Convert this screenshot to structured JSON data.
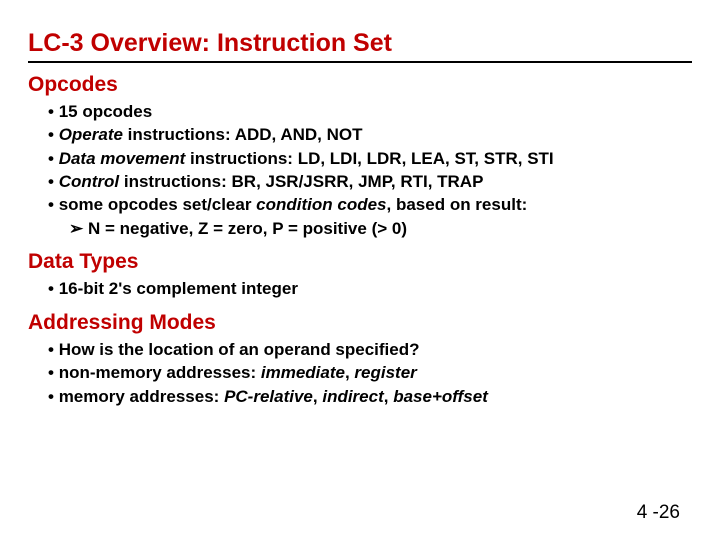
{
  "title": "LC-3 Overview: Instruction Set",
  "sections": {
    "opcodes": {
      "heading": "Opcodes",
      "b1": "15 opcodes",
      "b2_pre": "Operate",
      "b2_rest": " instructions: ADD, AND, NOT",
      "b3_pre": "Data movement",
      "b3_rest": " instructions: LD, LDI, LDR, LEA, ST, STR, STI",
      "b4_pre": "Control",
      "b4_rest": " instructions: BR, JSR/JSRR, JMP, RTI, TRAP",
      "b5_a": "some opcodes set/clear ",
      "b5_b": "condition codes",
      "b5_c": ", based on result:",
      "b5_sub": "N = negative, Z = zero, P = positive (> 0)"
    },
    "datatypes": {
      "heading": "Data Types",
      "b1": "16-bit 2's complement integer"
    },
    "addrmodes": {
      "heading": "Addressing Modes",
      "b1": "How is the location of an operand specified?",
      "b2_a": "non-memory addresses: ",
      "b2_b": "immediate",
      "b2_c": ", ",
      "b2_d": "register",
      "b3_a": "memory addresses: ",
      "b3_b": "PC-relative",
      "b3_c": ", ",
      "b3_d": "indirect",
      "b3_e": ", ",
      "b3_f": "base+offset"
    }
  },
  "pagenum": "4 -26"
}
